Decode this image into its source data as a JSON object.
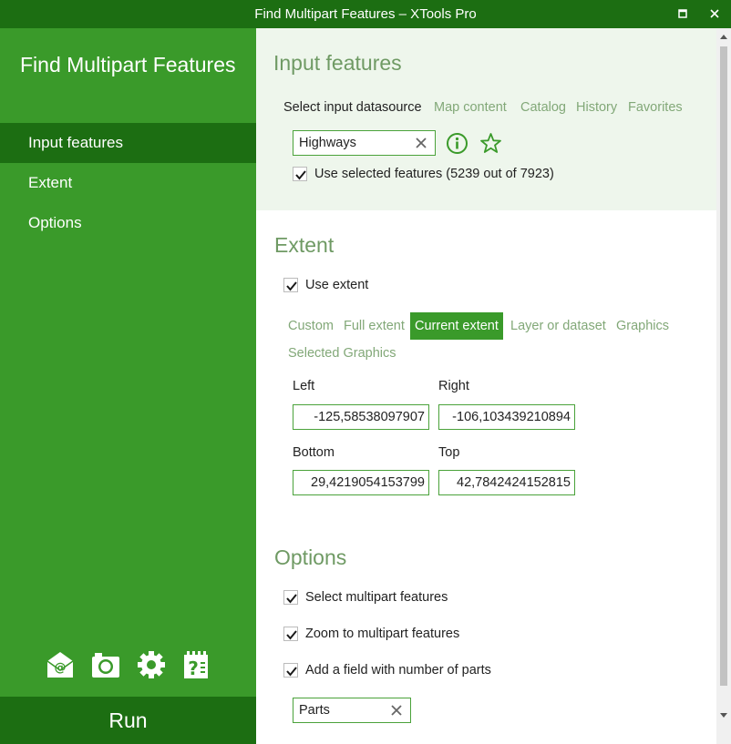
{
  "window": {
    "title": "Find Multipart Features – XTools Pro"
  },
  "sidebar": {
    "title": "Find Multipart Features",
    "nav": [
      {
        "label": "Input features",
        "active": true
      },
      {
        "label": "Extent",
        "active": false
      },
      {
        "label": "Options",
        "active": false
      }
    ],
    "icons": [
      "email-icon",
      "camera-icon",
      "gear-icon",
      "help-icon"
    ],
    "run_label": "Run"
  },
  "input_features": {
    "heading": "Input features",
    "select_label": "Select input datasource",
    "source_tabs": [
      "Map content",
      "Catalog",
      "History",
      "Favorites"
    ],
    "datasource_value": "Highways",
    "use_selected_label": "Use selected features (5239 out of 7923)",
    "use_selected_checked": true
  },
  "extent": {
    "heading": "Extent",
    "use_extent_label": "Use extent",
    "use_extent_checked": true,
    "tabs": [
      "Custom",
      "Full extent",
      "Current extent",
      "Layer or dataset",
      "Graphics",
      "Selected Graphics"
    ],
    "active_tab": "Current extent",
    "left_label": "Left",
    "left_value": "-125,58538097907",
    "right_label": "Right",
    "right_value": "-106,103439210894",
    "bottom_label": "Bottom",
    "bottom_value": "29,4219054153799",
    "top_label": "Top",
    "top_value": "42,7842424152815"
  },
  "options": {
    "heading": "Options",
    "items": [
      {
        "label": "Select multipart features",
        "checked": true
      },
      {
        "label": "Zoom to multipart features",
        "checked": true
      },
      {
        "label": "Add a field with number of parts",
        "checked": true
      }
    ],
    "field_name_value": "Parts"
  },
  "colors": {
    "dark_green": "#1c6e12",
    "green": "#3a9a2a",
    "light_bg": "#eef6ec",
    "muted_green": "#82a878"
  }
}
